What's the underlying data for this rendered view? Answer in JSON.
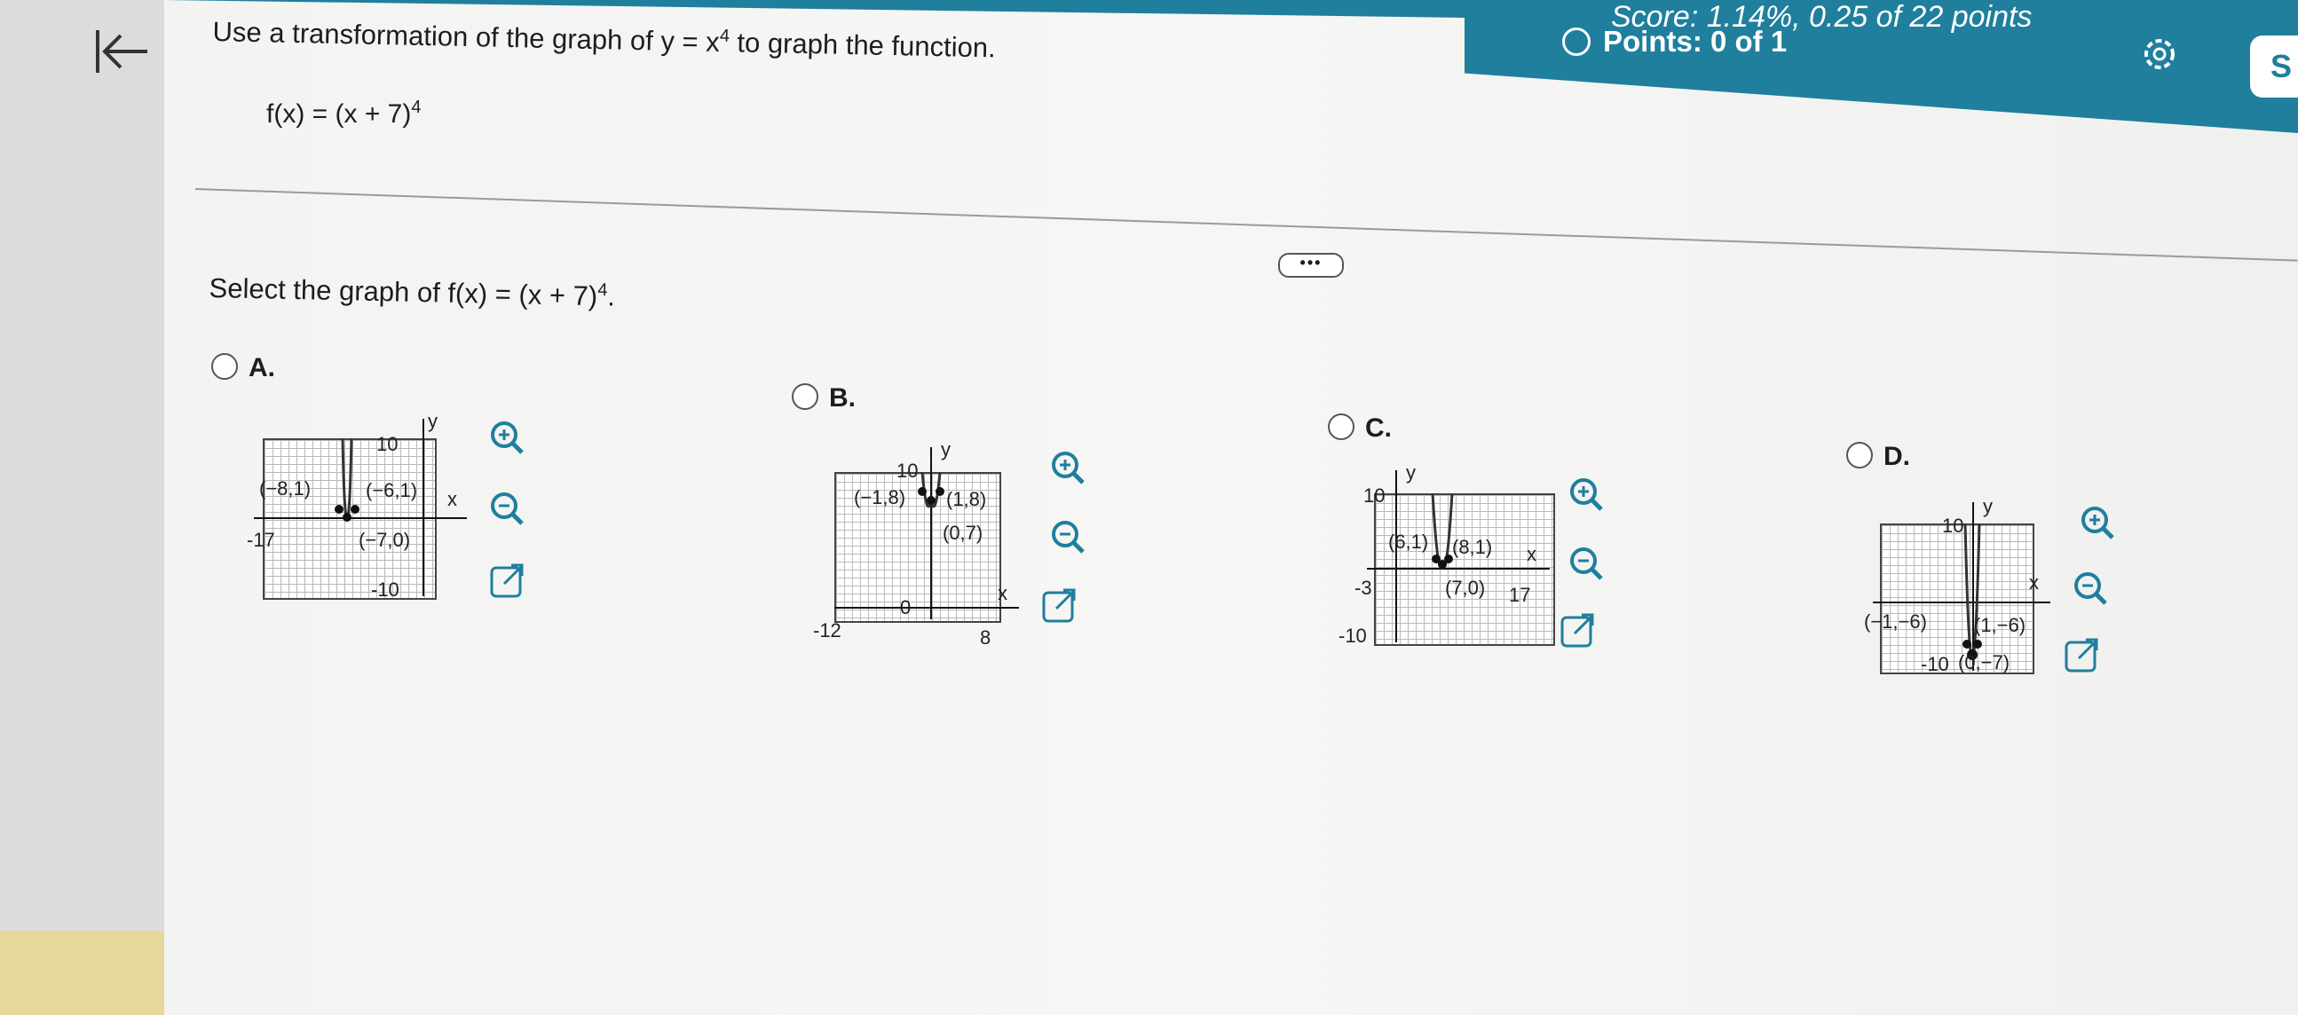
{
  "header": {
    "score": "Score: 1.14%, 0.25 of 22 points",
    "points": "Points: 0 of 1",
    "edge_badge": "S"
  },
  "question": {
    "text_pre": "Use a transformation of the graph of y = x",
    "text_exp": "4",
    "text_post": " to graph the function.",
    "func_base": "f(x) = (x + 7)",
    "func_exp": "4"
  },
  "more_label": "•••",
  "prompt": {
    "pre": "Select the graph of f(x) = (x + 7)",
    "exp": "4",
    "post": "."
  },
  "options": [
    {
      "letter": "A.",
      "ymax": "10",
      "ymin": "-10",
      "xmin": "-17",
      "y": "y",
      "x": "x",
      "points": [
        "(−8,1)",
        "(−6,1)",
        "(−7,0)"
      ]
    },
    {
      "letter": "B.",
      "ymax": "10",
      "ymin": "0",
      "xmin": "-12",
      "xmax": "8",
      "y": "y",
      "x": "x",
      "points": [
        "(−1,8)",
        "(1,8)",
        "(0,7)"
      ]
    },
    {
      "letter": "C.",
      "ymax": "10",
      "ymin": "-10",
      "xmin": "-3",
      "xmax": "17",
      "y": "y",
      "x": "x",
      "points": [
        "(6,1)",
        "(8,1)",
        "(7,0)"
      ]
    },
    {
      "letter": "D.",
      "ymax": "10",
      "ymin": "-10",
      "y": "y",
      "x": "x",
      "points": [
        "(−1,−6)",
        "(1,−6)",
        "(0,−7)"
      ]
    }
  ]
}
